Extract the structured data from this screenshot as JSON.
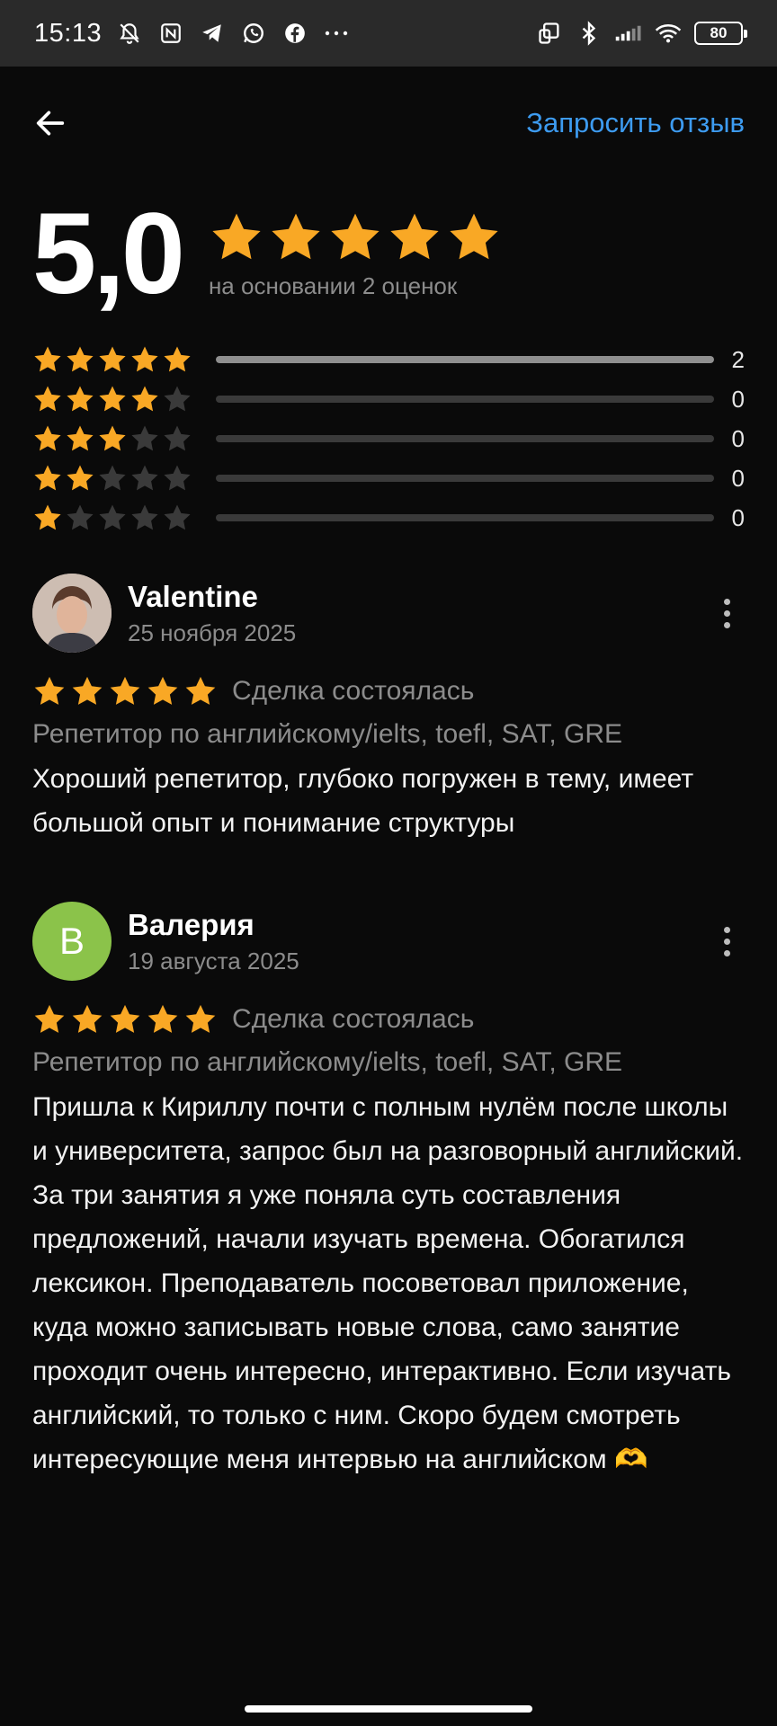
{
  "status_bar": {
    "time": "15:13",
    "icons": [
      "do-not-disturb-off-icon",
      "nfc-icon",
      "telegram-icon",
      "whatsapp-icon",
      "facebook-icon",
      "more-dots-icon"
    ],
    "right_icons": [
      "screen-mirror-icon",
      "bluetooth-icon",
      "signal-icon",
      "wifi-icon"
    ],
    "battery": "80"
  },
  "header": {
    "back_icon": "arrow-left-icon",
    "request_review": "Запросить отзыв"
  },
  "summary": {
    "rating": "5,0",
    "rating_value": 5,
    "based_on": "на основании 2 оценок"
  },
  "breakdown": [
    {
      "stars": 5,
      "count": "2",
      "fraction": 1.0
    },
    {
      "stars": 4,
      "count": "0",
      "fraction": 0
    },
    {
      "stars": 3,
      "count": "0",
      "fraction": 0
    },
    {
      "stars": 2,
      "count": "0",
      "fraction": 0
    },
    {
      "stars": 1,
      "count": "0",
      "fraction": 0
    }
  ],
  "colors": {
    "star": "#f9a825",
    "star_empty": "#3a3a3a",
    "link": "#3d9bf0",
    "avatar_letter_bg": "#8bc34a"
  },
  "reviews": [
    {
      "name": "Valentine",
      "date": "25 ноября 2025",
      "rating": 5,
      "status": "Сделка состоялась",
      "category": "Репетитор по английскому/ielts, toefl, SAT, GRE",
      "text": "Хороший репетитор, глубоко погружен в тему, имеет большой опыт и понимание структуры",
      "avatar": "photo"
    },
    {
      "name": "Валерия",
      "date": "19 августа 2025",
      "rating": 5,
      "status": "Сделка состоялась",
      "category": "Репетитор по английскому/ielts, toefl, SAT, GRE",
      "text": "Пришла к Кириллу почти с полным нулём после школы и университета, запрос был на разговорный английский. За три занятия я уже поняла суть составления предложений, начали изучать времена. Обогатился лексикон. Преподаватель посоветовал приложение, куда можно записывать новые слова, само занятие проходит очень интересно, интерактивно. Если изучать английский, то только с ним. Скоро будем смотреть интересующие меня интервью на английском 🫶",
      "avatar": "letter",
      "avatar_letter": "В"
    }
  ]
}
